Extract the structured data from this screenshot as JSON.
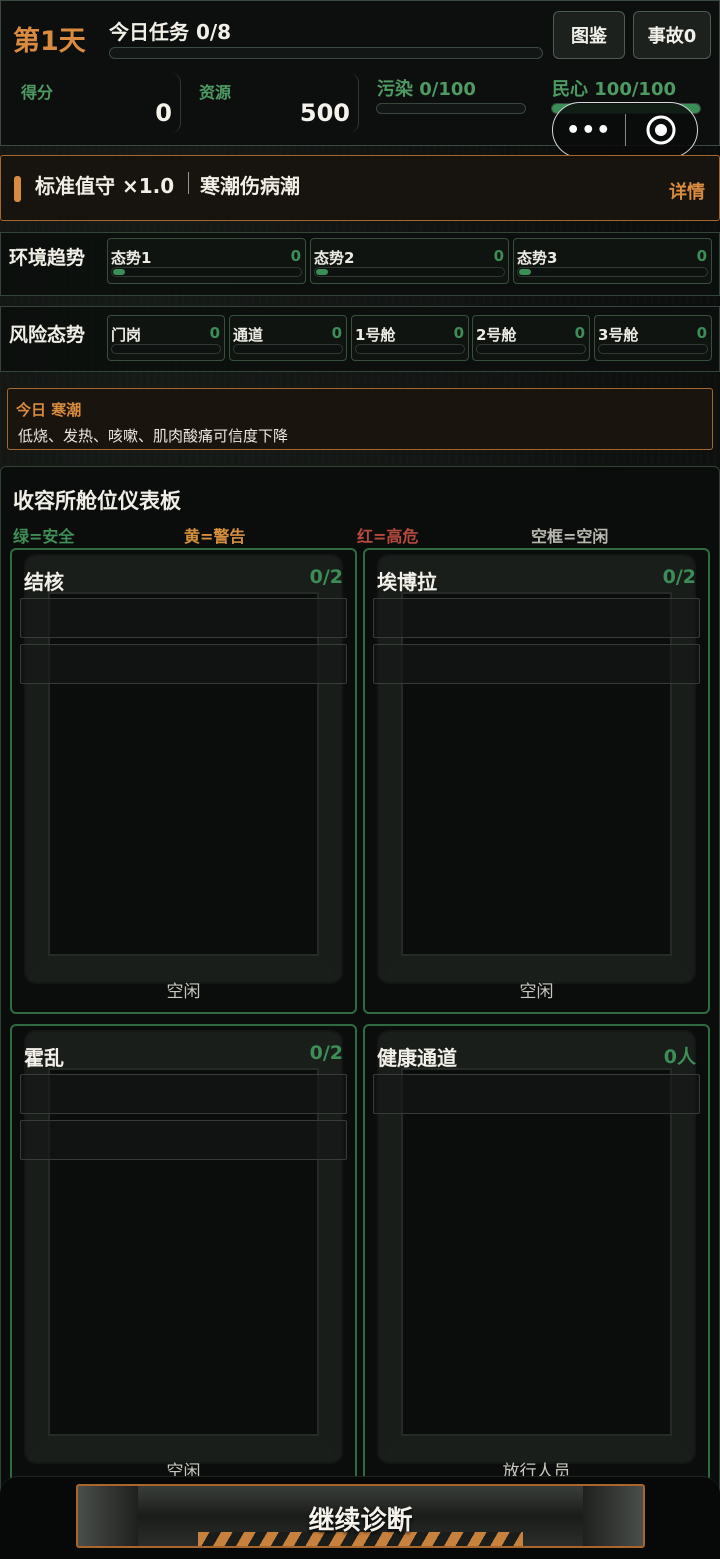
{
  "header": {
    "day": "第1天",
    "task": "今日任务 0/8",
    "task_progress": 0,
    "codex_button": "图鉴",
    "incident_button": "事故0",
    "score_label": "得分",
    "score_value": "0",
    "resource_label": "资源",
    "resource_value": "500",
    "pollution_label": "污染 0/100",
    "pollution_level": 0.0,
    "morale_label": "民心 100/100",
    "morale_level": 1.0,
    "capsule": {
      "more_icon": "more-icon",
      "close_icon": "close-target-icon",
      "more_text": "•••"
    }
  },
  "mode": {
    "difficulty": "标准值守 ×1.0",
    "event": "寒潮伤病潮",
    "detail_link": "详情"
  },
  "trends": {
    "title": "环境趋势",
    "items": [
      {
        "label": "态势1",
        "value": "0"
      },
      {
        "label": "态势2",
        "value": "0"
      },
      {
        "label": "态势3",
        "value": "0"
      }
    ]
  },
  "risks": {
    "title": "风险态势",
    "items": [
      {
        "label": "门岗",
        "value": "0"
      },
      {
        "label": "通道",
        "value": "0"
      },
      {
        "label": "1号舱",
        "value": "0"
      },
      {
        "label": "2号舱",
        "value": "0"
      },
      {
        "label": "3号舱",
        "value": "0"
      }
    ]
  },
  "today": {
    "title": "今日 寒潮",
    "description": "低烧、发热、咳嗽、肌肉酸痛可信度下降"
  },
  "dashboard": {
    "title": "收容所舱位仪表板",
    "legend": [
      "绿=安全",
      "黄=警告",
      "红=高危",
      "空框=空闲"
    ],
    "wards": [
      {
        "name": "结核",
        "count": "0/2",
        "status": "空闲"
      },
      {
        "name": "埃博拉",
        "count": "0/2",
        "status": "空闲"
      },
      {
        "name": "霍乱",
        "count": "0/2",
        "status": "空闲"
      },
      {
        "name": "健康通道",
        "count": "0人",
        "status": "放行人员"
      }
    ]
  },
  "continue_button": "继续诊断",
  "colors": {
    "accent_orange": "#d98b3f",
    "safe_green": "#3d8d57",
    "warning_yellow": "#d6903d",
    "danger_red": "#b64a3d"
  }
}
